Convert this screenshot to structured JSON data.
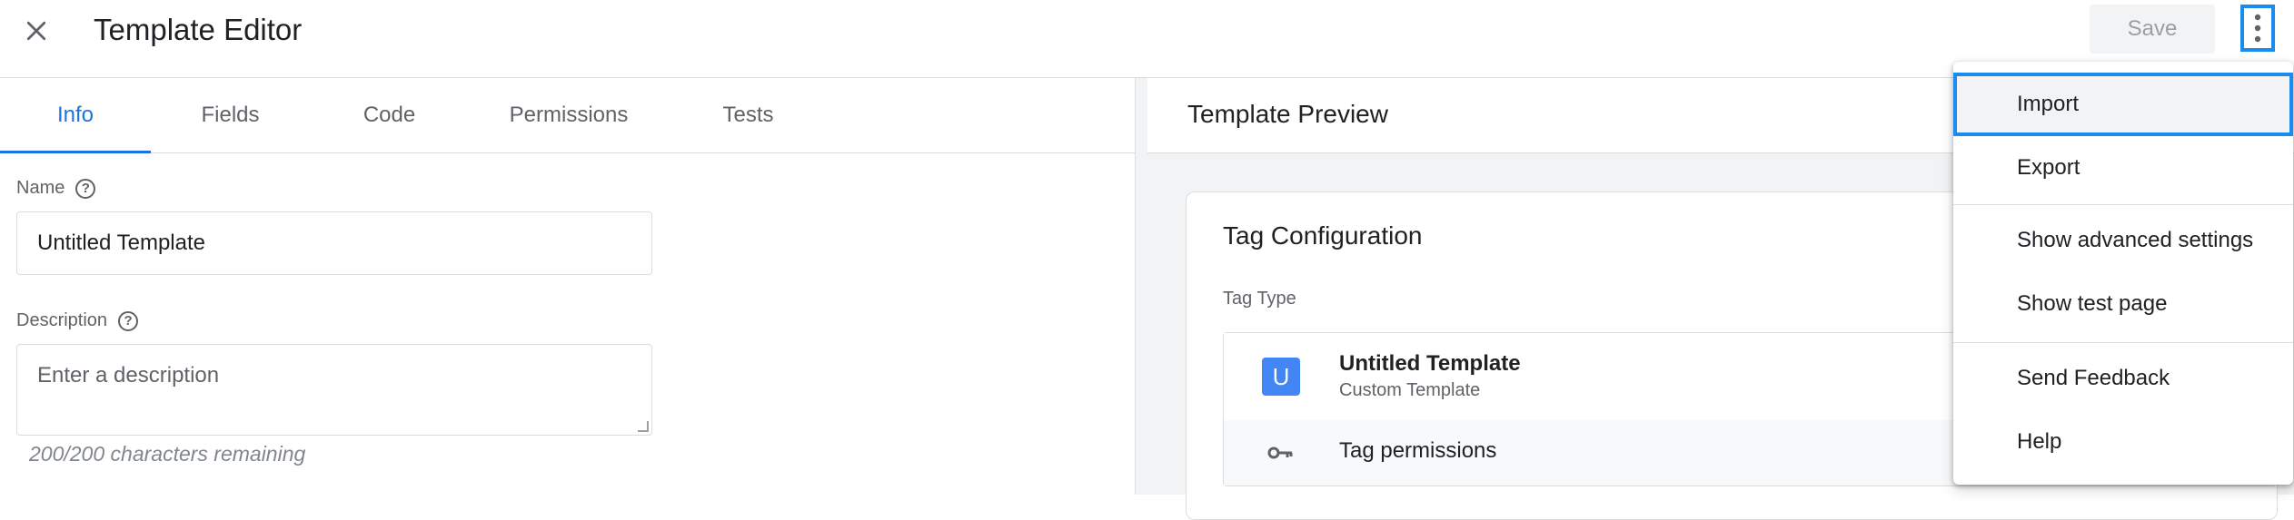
{
  "header": {
    "title": "Template Editor",
    "save_label": "Save"
  },
  "tabs": [
    {
      "label": "Info",
      "active": true
    },
    {
      "label": "Fields"
    },
    {
      "label": "Code"
    },
    {
      "label": "Permissions"
    },
    {
      "label": "Tests"
    }
  ],
  "info": {
    "name_label": "Name",
    "name_value": "Untitled Template",
    "description_label": "Description",
    "description_placeholder": "Enter a description",
    "char_count": "200/200 characters remaining"
  },
  "preview": {
    "title": "Template Preview",
    "card_title": "Tag Configuration",
    "tag_type_label": "Tag Type",
    "badge_letter": "U",
    "tag_name": "Untitled Template",
    "tag_subtitle": "Custom Template",
    "permissions_label": "Tag permissions"
  },
  "menu": {
    "items": [
      {
        "label": "Import",
        "highlighted": true
      },
      {
        "label": "Export"
      },
      {
        "label": "Show advanced settings"
      },
      {
        "label": "Show test page"
      },
      {
        "label": "Send Feedback"
      },
      {
        "label": "Help"
      }
    ]
  },
  "colors": {
    "accent": "#1a73e8",
    "highlight_border": "#1a8cf0",
    "badge": "#4285f4"
  },
  "icons": {
    "close": "close-icon",
    "help": "help-icon",
    "more": "more-vert-icon",
    "key": "key-icon"
  }
}
